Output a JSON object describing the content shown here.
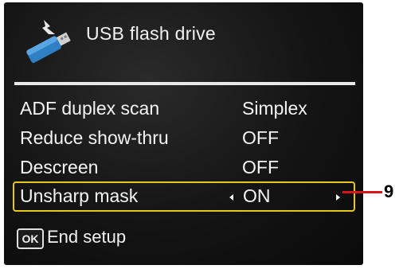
{
  "header": {
    "title": "USB flash drive",
    "icon": "usb-flash-drive-icon"
  },
  "settings": [
    {
      "label": "ADF duplex scan",
      "value": "Simplex",
      "selected": false
    },
    {
      "label": "Reduce show-thru",
      "value": "OFF",
      "selected": false
    },
    {
      "label": "Descreen",
      "value": "OFF",
      "selected": false
    },
    {
      "label": "Unsharp mask",
      "value": "ON",
      "selected": true
    }
  ],
  "footer": {
    "ok_key": "OK",
    "ok_label": "End setup"
  },
  "callout": {
    "number": "9",
    "color": "#d81418"
  },
  "colors": {
    "selection_border": "#e4c81e",
    "screen_background": "#141414",
    "text": "#f4f4f4"
  }
}
